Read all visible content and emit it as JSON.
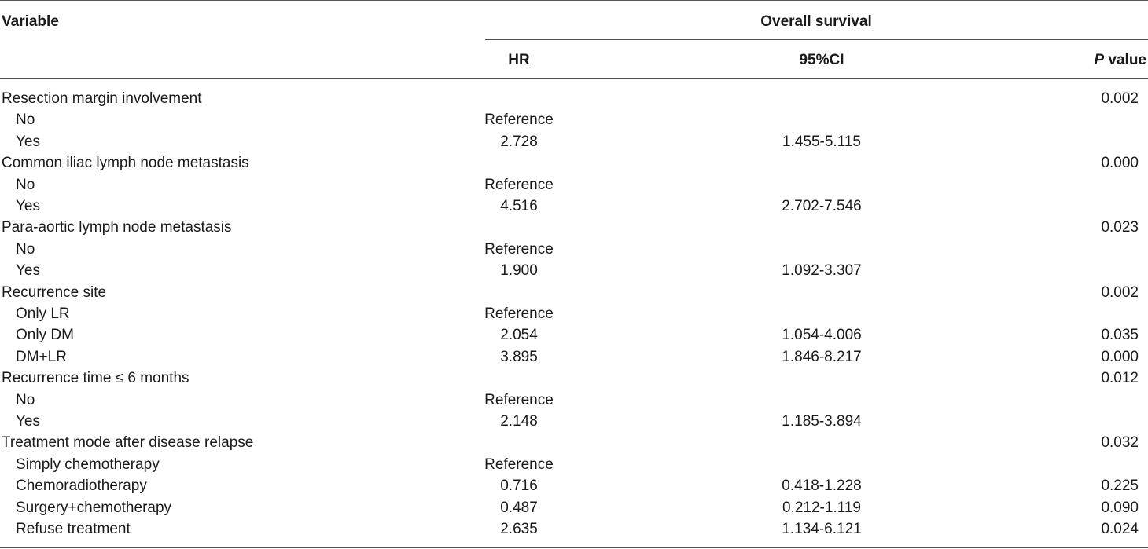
{
  "header": {
    "variable_label": "Variable",
    "group_label": "Overall survival",
    "hr_label": "HR",
    "ci_label": "95%CI",
    "p_italic": "P",
    "p_rest": " value"
  },
  "rows": [
    {
      "variable": "Resection margin involvement",
      "indent": false,
      "hr": "",
      "ci": "",
      "p": "0.002"
    },
    {
      "variable": "No",
      "indent": true,
      "hr": "Reference",
      "ci": "",
      "p": ""
    },
    {
      "variable": "Yes",
      "indent": true,
      "hr": "2.728",
      "ci": "1.455-5.115",
      "p": ""
    },
    {
      "variable": "Common iliac lymph node metastasis",
      "indent": false,
      "hr": "",
      "ci": "",
      "p": "0.000"
    },
    {
      "variable": "No",
      "indent": true,
      "hr": "Reference",
      "ci": "",
      "p": ""
    },
    {
      "variable": "Yes",
      "indent": true,
      "hr": "4.516",
      "ci": "2.702-7.546",
      "p": ""
    },
    {
      "variable": "Para-aortic lymph node metastasis",
      "indent": false,
      "hr": "",
      "ci": "",
      "p": "0.023"
    },
    {
      "variable": "No",
      "indent": true,
      "hr": "Reference",
      "ci": "",
      "p": ""
    },
    {
      "variable": "Yes",
      "indent": true,
      "hr": "1.900",
      "ci": "1.092-3.307",
      "p": ""
    },
    {
      "variable": "Recurrence site",
      "indent": false,
      "hr": "",
      "ci": "",
      "p": "0.002"
    },
    {
      "variable": "Only LR",
      "indent": true,
      "hr": "Reference",
      "ci": "",
      "p": ""
    },
    {
      "variable": "Only DM",
      "indent": true,
      "hr": "2.054",
      "ci": "1.054-4.006",
      "p": "0.035"
    },
    {
      "variable": "DM+LR",
      "indent": true,
      "hr": "3.895",
      "ci": "1.846-8.217",
      "p": "0.000"
    },
    {
      "variable": "Recurrence time ≤ 6 months",
      "indent": false,
      "hr": "",
      "ci": "",
      "p": "0.012"
    },
    {
      "variable": "No",
      "indent": true,
      "hr": "Reference",
      "ci": "",
      "p": ""
    },
    {
      "variable": "Yes",
      "indent": true,
      "hr": "2.148",
      "ci": "1.185-3.894",
      "p": ""
    },
    {
      "variable": "Treatment mode after disease relapse",
      "indent": false,
      "hr": "",
      "ci": "",
      "p": "0.032"
    },
    {
      "variable": "Simply chemotherapy",
      "indent": true,
      "hr": "Reference",
      "ci": "",
      "p": ""
    },
    {
      "variable": "Chemoradiotherapy",
      "indent": true,
      "hr": "0.716",
      "ci": "0.418-1.228",
      "p": "0.225"
    },
    {
      "variable": "Surgery+chemotherapy",
      "indent": true,
      "hr": "0.487",
      "ci": "0.212-1.119",
      "p": "0.090"
    },
    {
      "variable": "Refuse treatment",
      "indent": true,
      "hr": "2.635",
      "ci": "1.134-6.121",
      "p": "0.024"
    }
  ]
}
